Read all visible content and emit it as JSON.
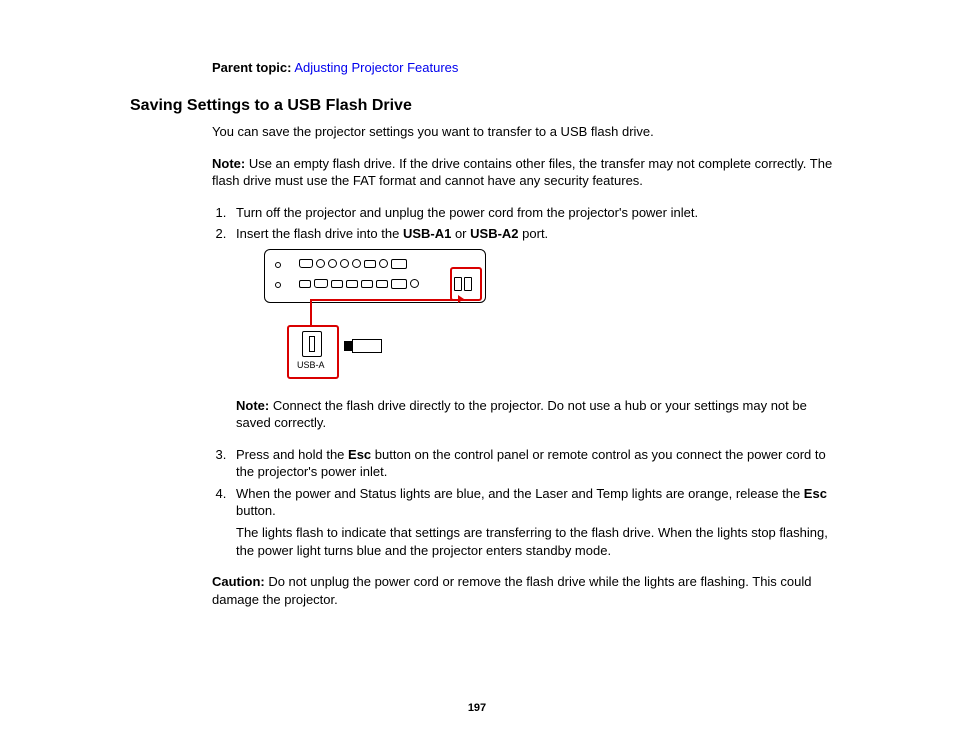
{
  "parent_topic": {
    "label": "Parent topic:",
    "link_text": "Adjusting Projector Features"
  },
  "heading": "Saving Settings to a USB Flash Drive",
  "intro": "You can save the projector settings you want to transfer to a USB flash drive.",
  "note1": {
    "label": "Note:",
    "text": " Use an empty flash drive. If the drive contains other files, the transfer may not complete correctly. The flash drive must use the FAT format and cannot have any security features."
  },
  "steps": {
    "s1": "Turn off the projector and unplug the power cord from the projector's power inlet.",
    "s2_pre": "Insert the flash drive into the ",
    "s2_b1": "USB-A1",
    "s2_mid": " or ",
    "s2_b2": "USB-A2",
    "s2_post": " port.",
    "s2_note_label": "Note:",
    "s2_note_text": " Connect the flash drive directly to the projector. Do not use a hub or your settings may not be saved correctly.",
    "s3_pre": "Press and hold the ",
    "s3_b1": "Esc",
    "s3_post": " button on the control panel or remote control as you connect the power cord to the projector's power inlet.",
    "s4_pre": "When the power and Status lights are blue, and the Laser and Temp lights are orange, release the ",
    "s4_b1": "Esc",
    "s4_post": " button.",
    "s4_body": "The lights flash to indicate that settings are transferring to the flash drive. When the lights stop flashing, the power light turns blue and the projector enters standby mode."
  },
  "caution": {
    "label": "Caution:",
    "text": " Do not unplug the power cord or remove the flash drive while the lights are flashing. This could damage the projector."
  },
  "diagram": {
    "usb_label": "USB-A"
  },
  "page_number": "197"
}
